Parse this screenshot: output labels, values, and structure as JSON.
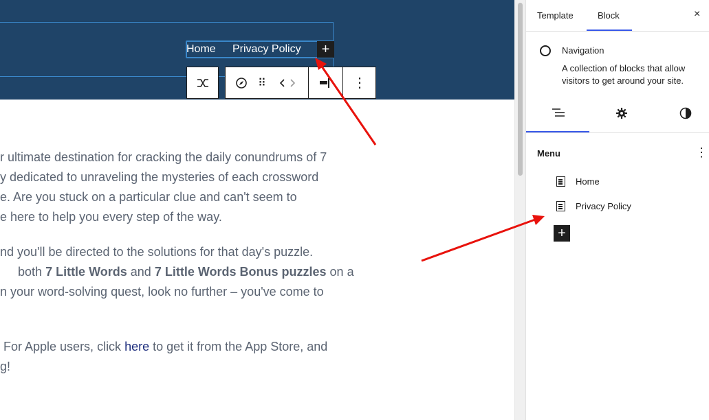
{
  "header": {
    "nav_links": [
      "Home",
      "Privacy Policy"
    ],
    "add_symbol": "+"
  },
  "toolbar": {
    "icons": [
      "transform-icon",
      "compass-icon",
      "drag-handle-icon",
      "move-arrows-icon",
      "justify-icon",
      "more-options-icon"
    ],
    "more": "⋮",
    "drag": "⠿"
  },
  "content": {
    "paragraphs": [
      [
        "r ultimate destination for cracking the daily conundrums of 7",
        "y dedicated to unraveling the mysteries of each crossword",
        "e. Are you stuck on a particular clue and can't seem to",
        "e here to help you every step of the way."
      ],
      [
        "nd you'll be directed to the solutions for that day's puzzle.",
        "both",
        "7 Little Words",
        "and",
        "7 Little Words Bonus puzzles",
        "on a",
        "n your word-solving quest, look no further – you've come to"
      ],
      [
        "For Apple users, click",
        "here",
        "to get it from the App Store, and",
        "g!"
      ]
    ]
  },
  "sidebar": {
    "tabs": [
      "Template",
      "Block"
    ],
    "close": "×",
    "block_name": "Navigation",
    "block_description": "A collection of blocks that allow visitors to get around your site.",
    "inner_tabs": [
      "list-view-icon",
      "settings-icon",
      "styles-icon"
    ],
    "menu": {
      "title": "Menu",
      "more": "⋮",
      "items": [
        "Home",
        "Privacy Policy"
      ],
      "add": "+"
    }
  },
  "annotations": {
    "arrow_color": "#e8120c"
  }
}
